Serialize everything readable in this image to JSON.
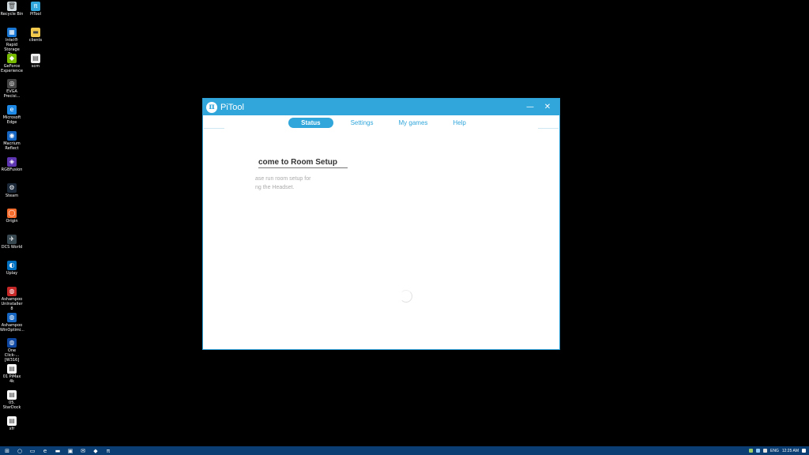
{
  "desktop": {
    "col1": [
      {
        "label": "Recycle Bin",
        "icon": "recycle-bin-icon",
        "color": "#cfd8dc",
        "glyph": "🗑"
      },
      {
        "label": "Intel® Rapid\nStorage Te...",
        "icon": "intel-storage-icon",
        "color": "#1976d2",
        "glyph": "▦"
      },
      {
        "label": "GeForce\nExperience",
        "icon": "geforce-icon",
        "color": "#76b900",
        "glyph": "◆"
      },
      {
        "label": "EVGA\nPrecisi...",
        "icon": "evga-icon",
        "color": "#444",
        "glyph": "◎"
      },
      {
        "label": "Microsoft\nEdge",
        "icon": "edge-icon",
        "color": "#1e88e5",
        "glyph": "e"
      },
      {
        "label": "Macrium\nReflect",
        "icon": "macrium-icon",
        "color": "#1565c0",
        "glyph": "◉"
      },
      {
        "label": "RGBFusion",
        "icon": "rgbfusion-icon",
        "color": "#5e35b1",
        "glyph": "◈"
      },
      {
        "label": "Steam",
        "icon": "steam-icon",
        "color": "#1b2838",
        "glyph": "⚙"
      },
      {
        "label": "Origin",
        "icon": "origin-icon",
        "color": "#f56c2d",
        "glyph": "◯"
      },
      {
        "label": "DCS World",
        "icon": "dcs-icon",
        "color": "#37474f",
        "glyph": "✈"
      },
      {
        "label": "Uplay",
        "icon": "uplay-icon",
        "color": "#0070c0",
        "glyph": "◐"
      },
      {
        "label": "Ashampoo\nUnInstaller 8",
        "icon": "ashampoo-uninstaller-icon",
        "color": "#c62828",
        "glyph": "◍"
      },
      {
        "label": "Ashampoo\nWinOptimi...",
        "icon": "ashampoo-winoptimizer-icon",
        "color": "#1565c0",
        "glyph": "◍"
      },
      {
        "label": "One Click-...\n[W316]",
        "icon": "oneclick-icon",
        "color": "#0d47a1",
        "glyph": "◍"
      },
      {
        "label": "01 PiMax 4k",
        "icon": "pimax-file-icon",
        "color": "#fff",
        "glyph": "▤"
      },
      {
        "label": "05. StarDock",
        "icon": "stardock-file-icon",
        "color": "#fff",
        "glyph": "▤"
      },
      {
        "label": "xfr",
        "icon": "xfr-file-icon",
        "color": "#fff",
        "glyph": "▤"
      }
    ],
    "col2": [
      {
        "label": "PiTool",
        "icon": "pitool-icon",
        "color": "#30a6db",
        "glyph": "π"
      },
      {
        "label": "clients",
        "icon": "folder-icon",
        "color": "#f2c94c",
        "glyph": "▬"
      },
      {
        "label": "scm",
        "icon": "scm-file-icon",
        "color": "#eee",
        "glyph": "▤"
      }
    ]
  },
  "window": {
    "title": "PiTool",
    "logo": "π",
    "minimize": "—",
    "close": "✕",
    "tabs": [
      "Status",
      "Settings",
      "My games",
      "Help"
    ],
    "active_tab": 0,
    "heading": "come to Room Setup",
    "description": "ase run room setup for\nng the Headset."
  },
  "taskbar": {
    "icons": [
      {
        "name": "start-icon",
        "glyph": "⊞"
      },
      {
        "name": "search-icon",
        "glyph": "○"
      },
      {
        "name": "task-view-icon",
        "glyph": "▭"
      },
      {
        "name": "edge-taskbar-icon",
        "glyph": "e"
      },
      {
        "name": "explorer-taskbar-icon",
        "glyph": "▬"
      },
      {
        "name": "store-taskbar-icon",
        "glyph": "▣"
      },
      {
        "name": "mail-taskbar-icon",
        "glyph": "✉"
      },
      {
        "name": "app-taskbar-icon",
        "glyph": "◆"
      },
      {
        "name": "pitool-taskbar-icon",
        "glyph": "π"
      }
    ],
    "lang": "ENG",
    "time": "12:25 AM"
  }
}
